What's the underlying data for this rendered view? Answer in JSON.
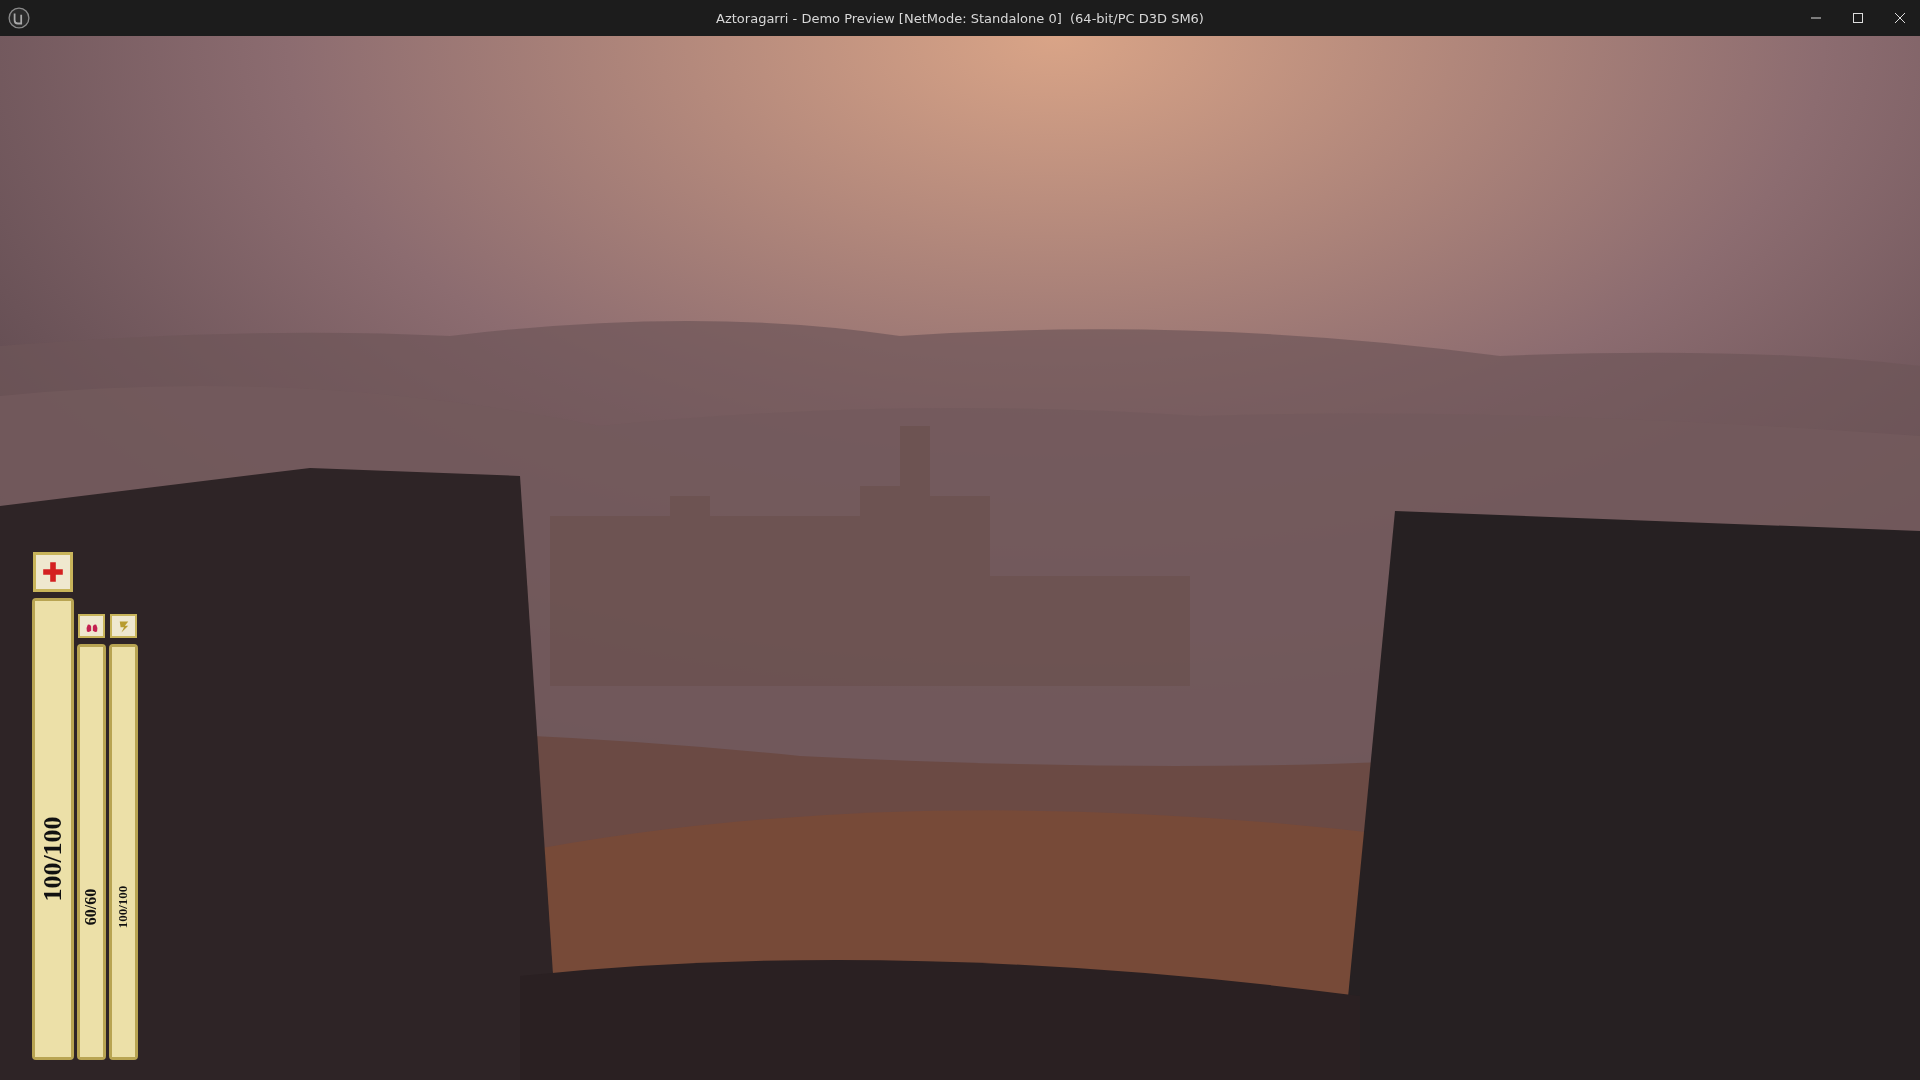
{
  "window": {
    "title": "Aztoragarri - Demo Preview [NetMode: Standalone 0]  (64-bit/PC D3D SM6)"
  },
  "hud": {
    "stats": [
      {
        "kind": "health",
        "reading": "100/100",
        "level": 1
      },
      {
        "kind": "breath",
        "reading": "60/60",
        "level": 1
      },
      {
        "kind": "stamina",
        "reading": "100/100",
        "level": 1
      }
    ]
  }
}
